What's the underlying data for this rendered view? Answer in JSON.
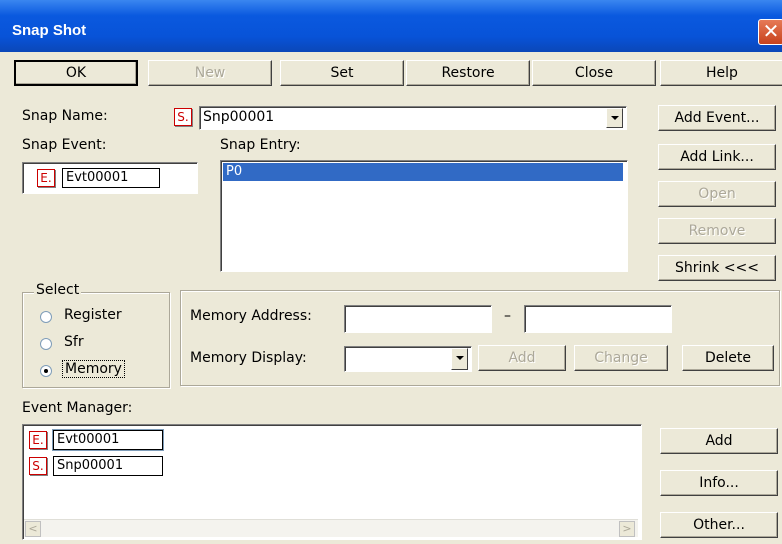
{
  "window": {
    "title": "Snap Shot",
    "close_glyph": "✕"
  },
  "toolbar": {
    "ok": "OK",
    "new": "New",
    "set": "Set",
    "restore": "Restore",
    "close": "Close",
    "help": "Help"
  },
  "snap_name": {
    "label": "Snap Name:",
    "badge": "S.",
    "value": "Snp00001"
  },
  "snap_event": {
    "label": "Snap Event:",
    "badge": "E.",
    "value": "Evt00001"
  },
  "snap_entry": {
    "label": "Snap Entry:",
    "items": [
      "P0"
    ]
  },
  "right_buttons": {
    "add_event": "Add Event...",
    "add_link": "Add Link...",
    "open": "Open",
    "remove": "Remove",
    "shrink": "Shrink <<<"
  },
  "select": {
    "title": "Select",
    "options": [
      "Register",
      "Sfr",
      "Memory"
    ],
    "selected": "Memory"
  },
  "memory": {
    "address_label": "Memory Address:",
    "address_from": "",
    "separator": "–",
    "address_to": "",
    "display_label": "Memory Display:",
    "display_value": "",
    "add": "Add",
    "change": "Change",
    "delete": "Delete"
  },
  "event_manager": {
    "label": "Event Manager:",
    "items": [
      {
        "badge": "E.",
        "name": "Evt00001"
      },
      {
        "badge": "S.",
        "name": "Snp00001"
      }
    ],
    "add": "Add",
    "info": "Info...",
    "other": "Other..."
  },
  "colors": {
    "title_bar": "#0a59df",
    "selection": "#316ac5",
    "badge": "#cc0000"
  }
}
